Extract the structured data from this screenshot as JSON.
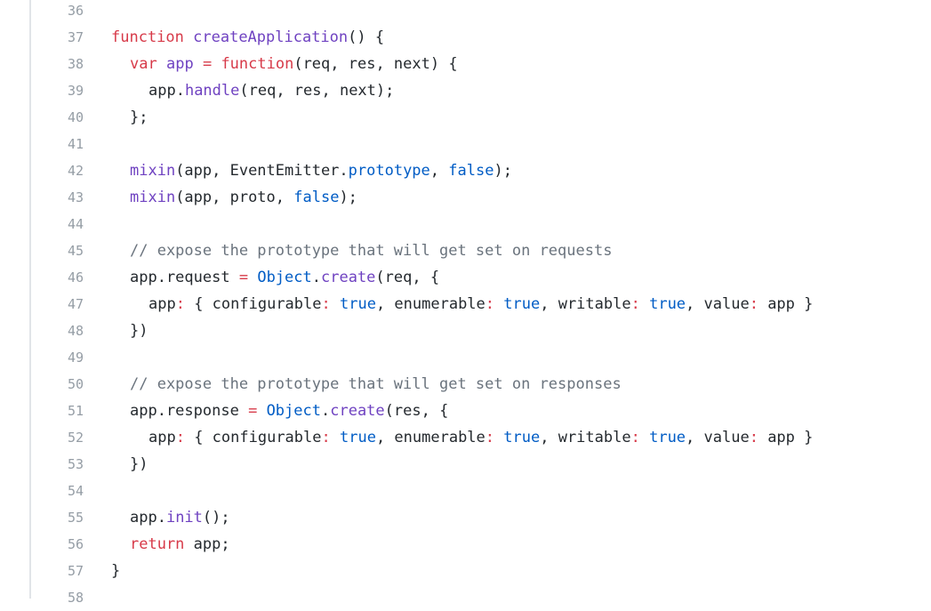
{
  "colors": {
    "keyword": "#d73a49",
    "function": "#6f42c1",
    "operator": "#d73a49",
    "constant": "#005cc5",
    "comment": "#6a737d",
    "plain": "#24292e",
    "line_number": "#959da5",
    "gutter_rule": "#e1e4e8",
    "background": "#ffffff"
  },
  "lines": [
    {
      "n": "36",
      "indent": 0,
      "tokens": []
    },
    {
      "n": "37",
      "indent": 0,
      "tokens": [
        [
          "kw",
          "function"
        ],
        [
          "pl",
          " "
        ],
        [
          "fn",
          "createApplication"
        ],
        [
          "pl",
          "() {"
        ]
      ]
    },
    {
      "n": "38",
      "indent": 1,
      "tokens": [
        [
          "kw",
          "var"
        ],
        [
          "pl",
          " "
        ],
        [
          "fn",
          "app"
        ],
        [
          "pl",
          " "
        ],
        [
          "op",
          "="
        ],
        [
          "pl",
          " "
        ],
        [
          "kw",
          "function"
        ],
        [
          "pl",
          "(req, res, next) {"
        ]
      ]
    },
    {
      "n": "39",
      "indent": 2,
      "tokens": [
        [
          "pl",
          "app."
        ],
        [
          "fn",
          "handle"
        ],
        [
          "pl",
          "(req, res, next);"
        ]
      ]
    },
    {
      "n": "40",
      "indent": 1,
      "tokens": [
        [
          "pl",
          "};"
        ]
      ]
    },
    {
      "n": "41",
      "indent": 0,
      "tokens": []
    },
    {
      "n": "42",
      "indent": 1,
      "tokens": [
        [
          "fn",
          "mixin"
        ],
        [
          "pl",
          "(app, EventEmitter."
        ],
        [
          "c",
          "prototype"
        ],
        [
          "pl",
          ", "
        ],
        [
          "c",
          "false"
        ],
        [
          "pl",
          ");"
        ]
      ]
    },
    {
      "n": "43",
      "indent": 1,
      "tokens": [
        [
          "fn",
          "mixin"
        ],
        [
          "pl",
          "(app, proto, "
        ],
        [
          "c",
          "false"
        ],
        [
          "pl",
          ");"
        ]
      ]
    },
    {
      "n": "44",
      "indent": 0,
      "tokens": []
    },
    {
      "n": "45",
      "indent": 1,
      "tokens": [
        [
          "cm",
          "// expose the prototype that will get set on requests"
        ]
      ]
    },
    {
      "n": "46",
      "indent": 1,
      "tokens": [
        [
          "pl",
          "app.request "
        ],
        [
          "op",
          "="
        ],
        [
          "pl",
          " "
        ],
        [
          "c",
          "Object"
        ],
        [
          "pl",
          "."
        ],
        [
          "fn",
          "create"
        ],
        [
          "pl",
          "(req, {"
        ]
      ]
    },
    {
      "n": "47",
      "indent": 2,
      "tokens": [
        [
          "pl",
          "app"
        ],
        [
          "op",
          ":"
        ],
        [
          "pl",
          " { configurable"
        ],
        [
          "op",
          ":"
        ],
        [
          "pl",
          " "
        ],
        [
          "c",
          "true"
        ],
        [
          "pl",
          ", enumerable"
        ],
        [
          "op",
          ":"
        ],
        [
          "pl",
          " "
        ],
        [
          "c",
          "true"
        ],
        [
          "pl",
          ", writable"
        ],
        [
          "op",
          ":"
        ],
        [
          "pl",
          " "
        ],
        [
          "c",
          "true"
        ],
        [
          "pl",
          ", value"
        ],
        [
          "op",
          ":"
        ],
        [
          "pl",
          " app }"
        ]
      ]
    },
    {
      "n": "48",
      "indent": 1,
      "tokens": [
        [
          "pl",
          "})"
        ]
      ]
    },
    {
      "n": "49",
      "indent": 0,
      "tokens": []
    },
    {
      "n": "50",
      "indent": 1,
      "tokens": [
        [
          "cm",
          "// expose the prototype that will get set on responses"
        ]
      ]
    },
    {
      "n": "51",
      "indent": 1,
      "tokens": [
        [
          "pl",
          "app.response "
        ],
        [
          "op",
          "="
        ],
        [
          "pl",
          " "
        ],
        [
          "c",
          "Object"
        ],
        [
          "pl",
          "."
        ],
        [
          "fn",
          "create"
        ],
        [
          "pl",
          "(res, {"
        ]
      ]
    },
    {
      "n": "52",
      "indent": 2,
      "tokens": [
        [
          "pl",
          "app"
        ],
        [
          "op",
          ":"
        ],
        [
          "pl",
          " { configurable"
        ],
        [
          "op",
          ":"
        ],
        [
          "pl",
          " "
        ],
        [
          "c",
          "true"
        ],
        [
          "pl",
          ", enumerable"
        ],
        [
          "op",
          ":"
        ],
        [
          "pl",
          " "
        ],
        [
          "c",
          "true"
        ],
        [
          "pl",
          ", writable"
        ],
        [
          "op",
          ":"
        ],
        [
          "pl",
          " "
        ],
        [
          "c",
          "true"
        ],
        [
          "pl",
          ", value"
        ],
        [
          "op",
          ":"
        ],
        [
          "pl",
          " app }"
        ]
      ]
    },
    {
      "n": "53",
      "indent": 1,
      "tokens": [
        [
          "pl",
          "})"
        ]
      ]
    },
    {
      "n": "54",
      "indent": 0,
      "tokens": []
    },
    {
      "n": "55",
      "indent": 1,
      "tokens": [
        [
          "pl",
          "app."
        ],
        [
          "fn",
          "init"
        ],
        [
          "pl",
          "();"
        ]
      ]
    },
    {
      "n": "56",
      "indent": 1,
      "tokens": [
        [
          "kw",
          "return"
        ],
        [
          "pl",
          " app;"
        ]
      ]
    },
    {
      "n": "57",
      "indent": 0,
      "tokens": [
        [
          "pl",
          "}"
        ]
      ]
    },
    {
      "n": "58",
      "indent": 0,
      "tokens": []
    }
  ]
}
